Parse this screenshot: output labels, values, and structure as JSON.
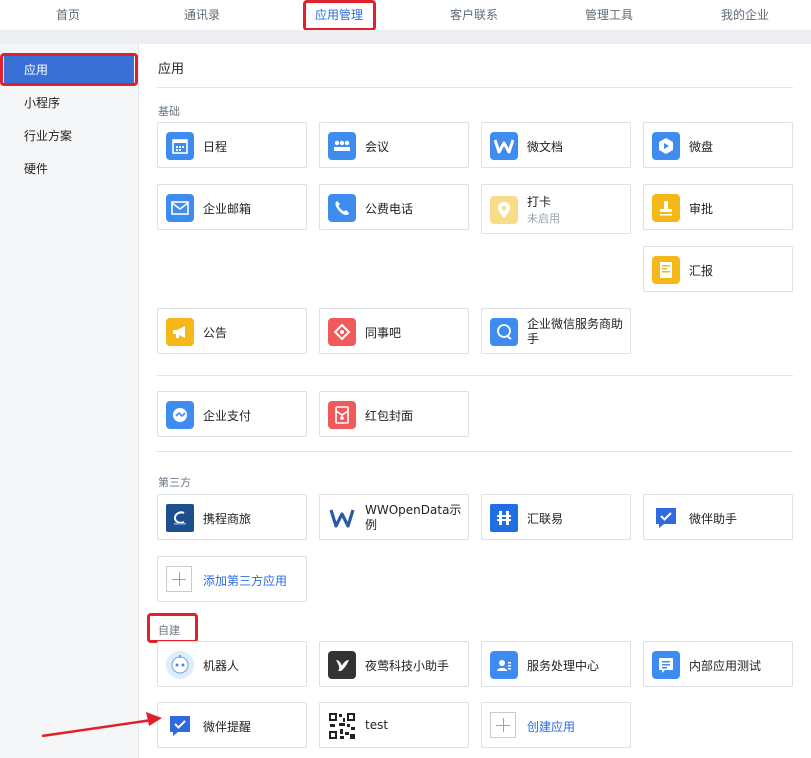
{
  "topnav": [
    "首页",
    "通讯录",
    "应用管理",
    "客户联系",
    "管理工具",
    "我的企业"
  ],
  "sidebar": [
    "应用",
    "小程序",
    "行业方案",
    "硬件"
  ],
  "main": {
    "title": "应用",
    "sections": {
      "basic": "基础",
      "third": "第三方",
      "custom": "自建"
    }
  },
  "apps": {
    "richeng": "日程",
    "huiyi": "会议",
    "weiwendang": "微文档",
    "weipan": "微盘",
    "youxiang": "企业邮箱",
    "dianhua": "公费电话",
    "daka": "打卡",
    "daka_status": "未启用",
    "shenpi": "审批",
    "huibao": "汇报",
    "gonggao": "公告",
    "tongshiba": "同事吧",
    "fuwushang": "企业微信服务商助手",
    "zhifu": "企业支付",
    "hongbao": "红包封面",
    "xiecheng": "携程商旅",
    "wwopendata": "WWOpenData示例",
    "huilianyi": "汇联易",
    "weiban": "微伴助手",
    "add_third": "添加第三方应用",
    "jiqiren": "机器人",
    "yeying": "夜莺科技小助手",
    "fuwuchuli": "服务处理中心",
    "neibu": "内部应用测试",
    "tixing": "微伴提醒",
    "test": "test",
    "create": "创建应用"
  },
  "colors": {
    "accent": "#2b6be0",
    "sidebar_active": "#3a6fd6",
    "highlight": "#e0202a"
  }
}
